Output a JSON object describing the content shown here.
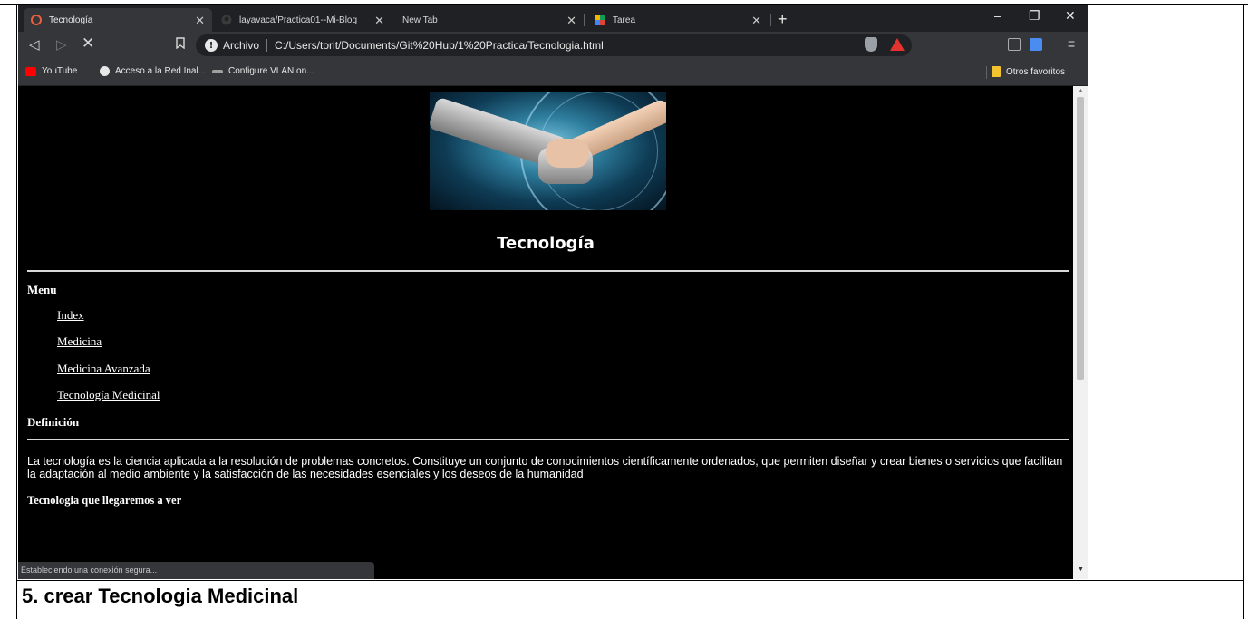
{
  "browser": {
    "tabs": [
      {
        "title": "Tecnología",
        "active": true
      },
      {
        "title": "layavaca/Practica01--Mi-Blog",
        "active": false
      },
      {
        "title": "New Tab",
        "active": false
      },
      {
        "title": "Tarea",
        "active": false
      }
    ],
    "address": {
      "scheme_label": "Archivo",
      "url": "C:/Users/torit/Documents/Git%20Hub/1%20Practica/Tecnologia.html"
    },
    "bookmarks": [
      {
        "label": "YouTube",
        "icon": "youtube-icon"
      },
      {
        "label": "Acceso a la Red Inal...",
        "icon": "globe-icon"
      },
      {
        "label": "Configure VLAN on...",
        "icon": "cisco-icon"
      }
    ],
    "other_bookmarks": "Otros favoritos",
    "status": "Estableciendo una conexión segura..."
  },
  "page": {
    "title": "Tecnología",
    "menu_heading": "Menu",
    "menu_links": [
      "Index",
      "Medicina",
      "Medicina Avanzada",
      "Tecnología Medicinal"
    ],
    "definition_heading": "Definición",
    "definition_text": "La tecnología es la ciencia aplicada a la resolución de problemas concretos. Constituye un conjunto de conocimientos científicamente ordenados, que permiten diseñar y crear bienes o servicios que facilitan la adaptación al medio ambiente y la satisfacción de las necesidades esenciales y los deseos de la humanidad",
    "subheading": "Tecnologia que llegaremos a ver"
  },
  "document": {
    "caption": "5. crear Tecnologia Medicinal"
  },
  "colors": {
    "tab_active": "#35363a",
    "chrome_dark": "#202124",
    "page_bg": "#000000",
    "brave_red": "#e2332f",
    "folder_yellow": "#f4c430"
  }
}
